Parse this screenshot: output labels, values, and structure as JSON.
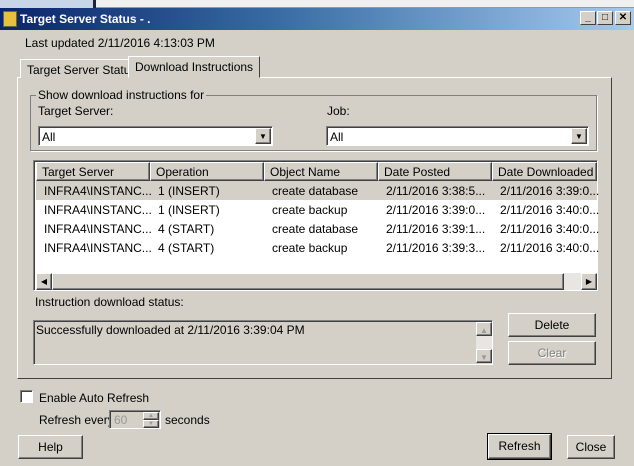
{
  "window": {
    "title": "Target Server Status - ."
  },
  "last_updated": "Last updated 2/11/2016 4:13:03 PM",
  "tabs": [
    {
      "label": "Target Server Status",
      "selected": false
    },
    {
      "label": "Download Instructions",
      "selected": true
    }
  ],
  "filter": {
    "group_label": "Show download instructions for",
    "target_server_label": "Target Server:",
    "target_server_value": "All",
    "job_label": "Job:",
    "job_value": "All"
  },
  "table": {
    "columns": [
      "Target Server",
      "Operation",
      "Object Name",
      "Date Posted",
      "Date Downloaded"
    ],
    "rows": [
      [
        "INFRA4\\INSTANC...",
        "1 (INSERT)",
        "create database",
        "2/11/2016 3:38:5...",
        "2/11/2016 3:39:0..."
      ],
      [
        "INFRA4\\INSTANC...",
        "1 (INSERT)",
        "create backup",
        "2/11/2016 3:39:0...",
        "2/11/2016 3:40:0..."
      ],
      [
        "INFRA4\\INSTANC...",
        "4 (START)",
        "create database",
        "2/11/2016 3:39:1...",
        "2/11/2016 3:40:0..."
      ],
      [
        "INFRA4\\INSTANC...",
        "4 (START)",
        "create backup",
        "2/11/2016 3:39:3...",
        "2/11/2016 3:40:0..."
      ]
    ],
    "selected_row": 0
  },
  "status": {
    "label": "Instruction download status:",
    "text": "Successfully downloaded at 2/11/2016 3:39:04 PM"
  },
  "buttons": {
    "delete": "Delete",
    "clear": "Clear",
    "help": "Help",
    "refresh": "Refresh",
    "close": "Close"
  },
  "auto_refresh": {
    "label": "Enable Auto Refresh",
    "checked": false,
    "refresh_every": "Refresh every",
    "interval": "60",
    "seconds": "seconds"
  }
}
